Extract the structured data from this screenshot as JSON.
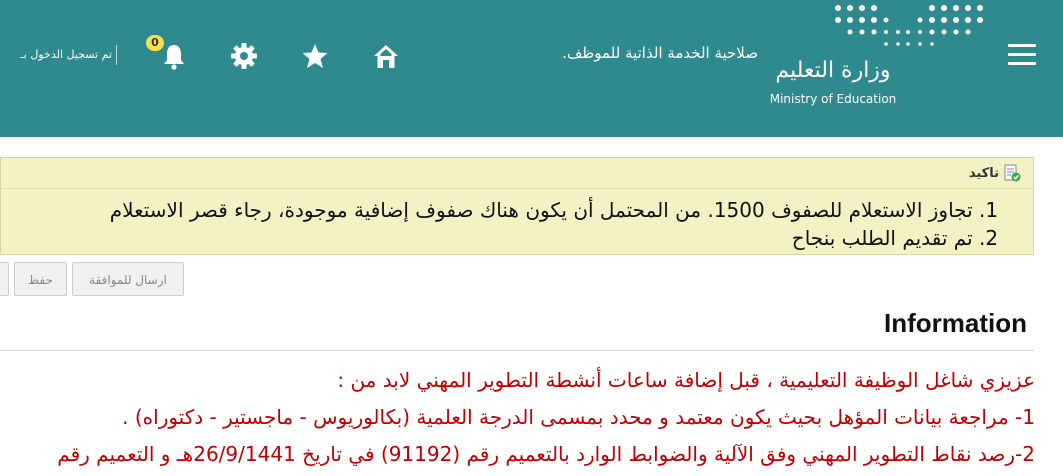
{
  "header": {
    "ministry_ar": "وزارة التعليم",
    "ministry_en": "Ministry of Education",
    "page_heading": "صلاحية الخدمة الذاتية للموظف.",
    "notification_count": "0",
    "login_status": "تم تسجيل الدخول بـ"
  },
  "icons": {
    "menu": "hamburger-icon",
    "home": "home-icon",
    "favorites": "star-icon",
    "settings": "gear-icon",
    "notifications": "bell-icon"
  },
  "alert": {
    "title": "تاكيد",
    "items": [
      {
        "num": "1.",
        "text": "تجاوز الاستعلام للصفوف 1500. من المحتمل أن يكون هناك صفوف إضافية موجودة، رجاء قصر الاستعلام"
      },
      {
        "num": "2.",
        "text": "تم تقديم الطلب بنجاح"
      }
    ]
  },
  "buttons": {
    "submit": "ارسال للموافقة",
    "save": "حفظ"
  },
  "info": {
    "title": "Information",
    "lines": [
      "عزيزي شاغل الوظيفة التعليمية ، قبل إضافة ساعات أنشطة التطوير المهني لابد من :",
      "1- مراجعة بيانات المؤهل بحيث يكون معتمد و محدد بمسمى الدرجة العلمية (بكالوريوس - ماجستير - دكتوراه) .",
      "2-رصد نقاط التطوير المهني وفق الآلية والضوابط الوارد بالتعميم رقم (91192) في تاريخ 26/9/1441هـ و التعميم رقم"
    ]
  },
  "colors": {
    "header_bg": "#2e8a8e",
    "alert_bg": "#f2f2c5",
    "info_text": "#c00000",
    "badge": "#f2e14a"
  }
}
